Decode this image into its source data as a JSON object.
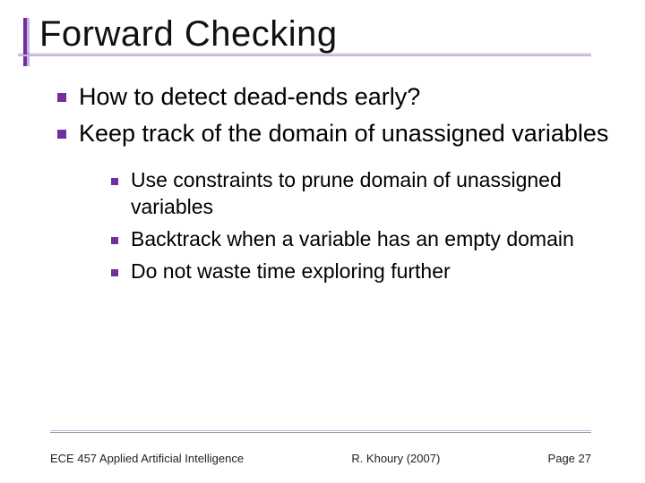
{
  "title": "Forward Checking",
  "bullets_lvl1": [
    "How to detect dead-ends early?",
    "Keep track of the domain of unassigned variables"
  ],
  "bullets_lvl2": [
    "Use constraints to prune domain of unassigned variables",
    "Backtrack when a variable has an empty domain",
    "Do not waste time exploring further"
  ],
  "footer": {
    "left": "ECE 457 Applied Artificial Intelligence",
    "center": "R. Khoury (2007)",
    "right": "Page 27"
  }
}
